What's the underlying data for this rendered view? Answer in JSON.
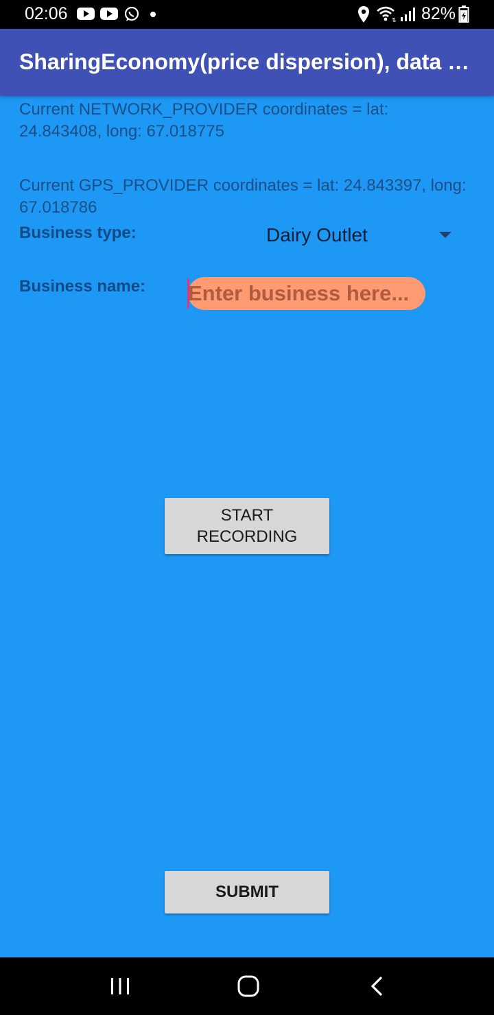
{
  "status_bar": {
    "time": "02:06",
    "battery": "82%",
    "left_icons": [
      "youtube-icon",
      "youtube-icon",
      "whatsapp-icon",
      "dot-icon"
    ],
    "right_icons": [
      "location-icon",
      "wifi-icon",
      "signal-icon",
      "battery-icon"
    ]
  },
  "app_bar": {
    "title": "SharingEconomy(price dispersion), data collection",
    "color": "#3F51B5"
  },
  "location": {
    "network_text": "Current NETWORK_PROVIDER coordinates = lat: 24.843408, long: 67.018775",
    "gps_text": "Current GPS_PROVIDER coordinates = lat: 24.843397, long: 67.018786"
  },
  "form": {
    "business_type_label": "Business type:",
    "business_type_value": "Dairy Outlet",
    "business_name_label": "Business name:",
    "business_name_value": "",
    "business_name_placeholder": "Enter business here..."
  },
  "buttons": {
    "record_line1": "START",
    "record_line2": "RECORDING",
    "submit": "SUBMIT"
  },
  "nav_bar": {
    "icons": [
      "recents-icon",
      "home-icon",
      "back-icon"
    ]
  },
  "colors": {
    "background": "#1E98F5",
    "input_fill": "#FF9B73",
    "button": "#D6D7D7"
  }
}
